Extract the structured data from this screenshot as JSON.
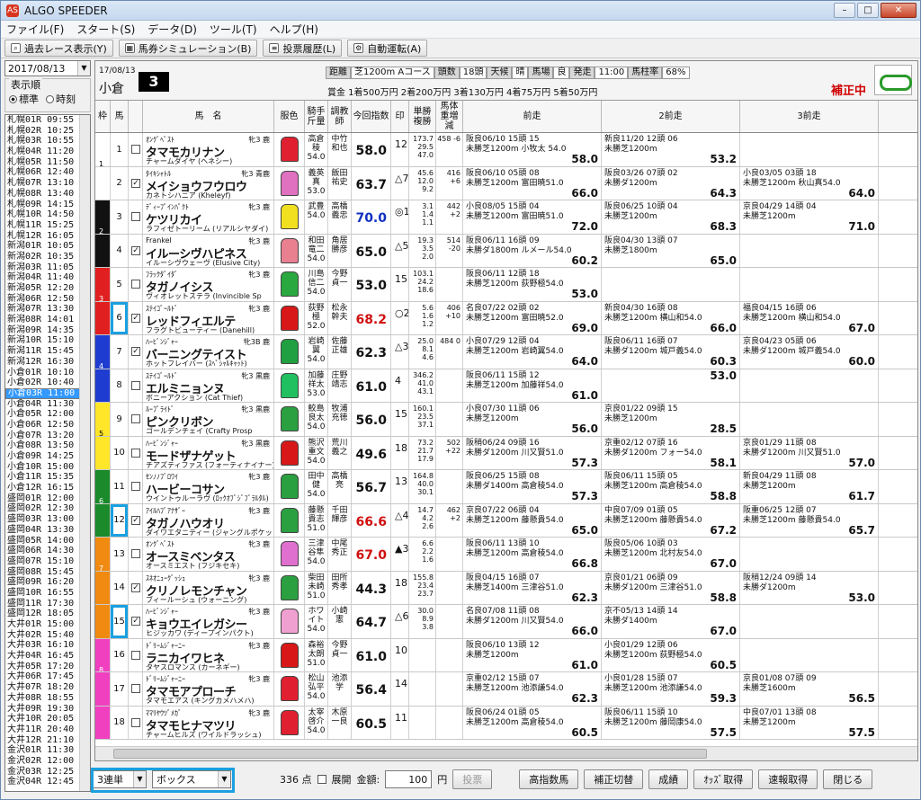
{
  "window": {
    "title": "ALGO SPEEDER"
  },
  "menu": [
    "ファイル(F)",
    "スタート(S)",
    "データ(D)",
    "ツール(T)",
    "ヘルプ(H)"
  ],
  "toolbar": [
    {
      "label": "過去レース表示(Y)",
      "icon": "search-icon"
    },
    {
      "label": "馬券シミュレーション(B)",
      "icon": "grid-icon"
    },
    {
      "label": "投票履歴(L)",
      "icon": "list-icon"
    },
    {
      "label": "自動運転(A)",
      "icon": "gear-icon"
    }
  ],
  "left": {
    "date": "2017/08/13",
    "order_label": "表示順",
    "opt1": "標準",
    "opt2": "時刻",
    "races": [
      "札幌01R 09:55",
      "札幌02R 10:25",
      "札幌03R 10:55",
      "札幌04R 11:20",
      "札幌05R 11:50",
      "札幌06R 12:40",
      "札幌07R 13:10",
      "札幌08R 13:40",
      "札幌09R 14:15",
      "札幌10R 14:50",
      "札幌11R 15:25",
      "札幌12R 16:05",
      "新潟01R 10:05",
      "新潟02R 10:35",
      "新潟03R 11:05",
      "新潟04R 11:40",
      "新潟05R 12:20",
      "新潟06R 12:50",
      "新潟07R 13:30",
      "新潟08R 14:01",
      "新潟09R 14:35",
      "新潟10R 15:10",
      "新潟11R 15:45",
      "新潟12R 16:30",
      "小倉01R 10:10",
      "小倉02R 10:40",
      "小倉03R 11:00",
      "小倉04R 11:30",
      "小倉05R 12:00",
      "小倉06R 12:50",
      "小倉07R 13:20",
      "小倉08R 13:50",
      "小倉09R 14:25",
      "小倉10R 15:00",
      "小倉11R 15:35",
      "小倉12R 16:15",
      "盛岡01R 12:00",
      "盛岡02R 12:30",
      "盛岡03R 13:00",
      "盛岡04R 13:30",
      "盛岡05R 14:00",
      "盛岡06R 14:30",
      "盛岡07R 15:10",
      "盛岡08R 15:45",
      "盛岡09R 16:20",
      "盛岡10R 16:55",
      "盛岡11R 17:30",
      "盛岡12R 18:05",
      "大井01R 15:00",
      "大井02R 15:40",
      "大井03R 16:10",
      "大井04R 16:45",
      "大井05R 17:20",
      "大井06R 17:45",
      "大井07R 18:20",
      "大井08R 18:55",
      "大井09R 19:30",
      "大井10R 20:05",
      "大井11R 20:40",
      "大井12R 21:10",
      "金沢01R 11:30",
      "金沢02R 12:00",
      "金沢03R 12:25",
      "金沢04R 12:45"
    ],
    "selected_index": 26
  },
  "header": {
    "date": "17/08/13",
    "venue": "小倉",
    "race_no": "3",
    "info": [
      [
        "距離",
        true
      ],
      [
        "芝1200m Aコース",
        false
      ],
      [
        "頭数",
        true
      ],
      [
        "18頭",
        false
      ],
      [
        "天候",
        true
      ],
      [
        "晴",
        false
      ],
      [
        "馬場",
        true
      ],
      [
        "良",
        false
      ],
      [
        "発走",
        true
      ],
      [
        "11:00",
        false
      ],
      [
        "馬柱率",
        true
      ],
      [
        "68%",
        false
      ]
    ],
    "prize": "賞金 1着500万円 2着200万円 3着130万円 4着75万円 5着50万円",
    "status": "補正中"
  },
  "columns": [
    "枠",
    "馬",
    "",
    "馬　名",
    "服色",
    "騎手斤量",
    "調教師",
    "今回指数",
    "印",
    "単勝複勝",
    "馬体重増減",
    "前走",
    "2前走",
    "3前走"
  ],
  "horses": [
    {
      "waku": 1,
      "num": "1",
      "chk": false,
      "sire": "ｵﾝｸﾞﾍﾞｽﾄ",
      "tag": "牝3 鹿",
      "name": "タマモカリナン",
      "dam": "チャームダイヤ (ヘネシー)",
      "silk": "#e02030",
      "jockey": "高倉稜 54.0",
      "trainer": "中竹和也",
      "idx": "58.0",
      "ic": "",
      "mark": "12",
      "odds": "173.7 29.5 47.0",
      "wt": "458 -6",
      "p1": "阪良06/10 15頭 15",
      "p1b": "未勝芝1200m 小牧太 54.0",
      "p1c": "58.0",
      "p2": "新良11/20 12頭 06",
      "p2b": "未勝芝1200m",
      "p2c": "53.2",
      "p3": "",
      "p3b": "",
      "p3c": ""
    },
    {
      "waku": 1,
      "num": "2",
      "chk": true,
      "sire": "ﾀｲｷｼｬﾄﾙ",
      "tag": "牝3 青鹿",
      "name": "メイショウフウロウ",
      "dam": "カネトシハニア (Kheleyf)",
      "silk": "#e070c0",
      "jockey": "義英真 53.0",
      "trainer": "飯田祐史",
      "idx": "63.7",
      "ic": "",
      "mark": "△7",
      "odds": "45.6 12.0 9.2",
      "wt": "416 +6",
      "p1": "阪良06/10 05頭 08",
      "p1b": "未勝芝1200m 富田暁51.0",
      "p1c": "66.0",
      "p2": "阪良03/26 07頭 02",
      "p2b": "未勝ダ1200m",
      "p2c": "64.3",
      "p3": "小良03/05 03頭 18",
      "p3b": "未勝芝1200m 秋山真54.0",
      "p3c": "64.0"
    },
    {
      "waku": 2,
      "num": "3",
      "chk": false,
      "sire": "ﾃﾞｨｰﾌﾟｲﾝﾊﾟｸﾄ",
      "tag": "牝3 鹿",
      "name": "ケツリカイ",
      "dam": "ラフィゼトーリーム (リアルシヤダイ)",
      "silk": "#f0e020",
      "jockey": "武豊 54.0",
      "trainer": "高橋義忠",
      "idx": "70.0",
      "ic": "blue",
      "mark": "◎1",
      "odds": "3.1 1.4 1.1",
      "wt": "442 +2",
      "p1": "小良08/05 15頭 04",
      "p1b": "未勝芝1200m 富田暁51.0",
      "p1c": "72.0",
      "p2": "阪良06/25 10頭 04",
      "p2b": "未勝芝1200m",
      "p2c": "68.3",
      "p3": "京良04/29 14頭 04",
      "p3b": "未勝芝1200m",
      "p3c": "71.0"
    },
    {
      "waku": 2,
      "num": "4",
      "chk": true,
      "sire": "Frankel",
      "tag": "牝3 鹿",
      "name": "イルーシヴハピネス",
      "dam": "イルーシヴウェーヴ (Elusive City)",
      "silk": "#e88090",
      "jockey": "和田竜二 54.0",
      "trainer": "角居勝彦",
      "idx": "65.0",
      "ic": "",
      "mark": "△5",
      "odds": "19.3 3.5 2.0",
      "wt": "514 -20",
      "p1": "阪良06/11 16頭 09",
      "p1b": "未勝ダ1800m ルメール54.0",
      "p1c": "60.2",
      "p2": "阪良04/30 13頭 07",
      "p2b": "未勝芝1800m",
      "p2c": "65.0",
      "p3": "",
      "p3b": "",
      "p3c": ""
    },
    {
      "waku": 3,
      "num": "5",
      "chk": false,
      "sire": "ﾌﾗｯｸﾀﾞｲﾀﾞ",
      "tag": "牝3 鹿",
      "name": "タガノイシス",
      "dam": "ヴィオレットステラ (Invincible Sp",
      "silk": "#2aa840",
      "jockey": "川島信二 54.0",
      "trainer": "今野貞一",
      "idx": "53.0",
      "ic": "",
      "mark": "15",
      "odds": "103.1 24.2 18.6",
      "wt": "",
      "p1": "阪良06/11 12頭 18",
      "p1b": "未勝芝1200m 荻野極54.0",
      "p1c": "53.0",
      "p2": "",
      "p2b": "",
      "p2c": "",
      "p3": "",
      "p3b": "",
      "p3c": ""
    },
    {
      "waku": 3,
      "num": "6",
      "chk": true,
      "hl": true,
      "sire": "ｽﾃｲｺﾞｰﾙﾄﾞ",
      "tag": "牝3 鹿",
      "name": "レッドフィエルテ",
      "dam": "フラグトビューティー (Danehill)",
      "silk": "#d81818",
      "jockey": "荻野極 52.0",
      "trainer": "松永幹夫",
      "idx": "68.2",
      "ic": "red",
      "mark": "○2",
      "odds": "5.6 1.6 1.2",
      "wt": "406 +10",
      "p1": "名良07/22 02頭 02",
      "p1b": "未勝芝1200m 富田暁52.0",
      "p1c": "69.0",
      "p2": "新良04/30 16頭 08",
      "p2b": "未勝芝1200m 横山和54.0",
      "p2c": "66.0",
      "p3": "福良04/15 16頭 06",
      "p3b": "未勝芝1200m 横山和54.0",
      "p3c": "67.0"
    },
    {
      "waku": 4,
      "num": "7",
      "chk": true,
      "sire": "ﾊｰﾋﾞﾝｼﾞｬｰ",
      "tag": "牝3B 鹿",
      "name": "バーニングテイスト",
      "dam": "ホットフレイバー (ｽﾍﾟｼｬﾙｷｬｯﾄ)",
      "silk": "#20a040",
      "jockey": "岩崎翼 54.0",
      "trainer": "佐藤正雄",
      "idx": "62.3",
      "ic": "",
      "mark": "△3",
      "odds": "25.0 8.1 4.6",
      "wt": "484 0",
      "p1": "小良07/29 12頭 04",
      "p1b": "未勝芝1200m 岩崎翼54.0",
      "p1c": "64.0",
      "p2": "阪良06/11 16頭 07",
      "p2b": "未勝ダ1200m 城戸義54.0",
      "p2c": "60.3",
      "p3": "京良04/23 05頭 06",
      "p3b": "未勝ダ1200m 城戸義54.0",
      "p3c": "60.0"
    },
    {
      "waku": 4,
      "num": "8",
      "chk": false,
      "sire": "ｽﾃｲｺﾞｰﾙﾄﾞ",
      "tag": "牝3 黒鹿",
      "name": "エルミニョンヌ",
      "dam": "ボニーアクション (Cat Thief)",
      "silk": "#20c060",
      "jockey": "加藤祥太 53.0",
      "trainer": "庄野靖志",
      "idx": "61.0",
      "ic": "",
      "mark": "4",
      "odds": "346.2 41.0 43.1",
      "wt": "",
      "p1": "阪良06/11 15頭 12",
      "p1b": "未勝芝1200m 加藤祥54.0",
      "p1c": "61.0",
      "p2": "",
      "p2b": "",
      "p2c": "53.0",
      "p3": "",
      "p3b": "",
      "p3c": ""
    },
    {
      "waku": 5,
      "num": "9",
      "chk": false,
      "sire": "ﾙｰﾌﾟﾗｲﾄﾞ",
      "tag": "牝3 黒鹿",
      "name": "ピンクリボン",
      "dam": "ゴールデンチェイ (Crafty Prosp",
      "silk": "#2aa040",
      "jockey": "鮫島良太 54.0",
      "trainer": "牧浦充徳",
      "idx": "56.0",
      "ic": "",
      "mark": "15",
      "odds": "160.1 23.5 37.1",
      "wt": "",
      "p1": "小良07/30 11頭 06",
      "p1b": "未勝芝1200m",
      "p1c": "56.0",
      "p2": "京良01/22 09頭 15",
      "p2b": "未勝芝1200m",
      "p2c": "28.5",
      "p3": "",
      "p3b": "",
      "p3c": ""
    },
    {
      "waku": 5,
      "num": "10",
      "chk": false,
      "sire": "ﾊｰﾋﾞﾝｼﾞｬｰ",
      "tag": "牝3 黒鹿",
      "name": "モードザナゲット",
      "dam": "チアズティファス (フォーティナイナー)",
      "silk": "#d81818",
      "jockey": "熊沢重文 54.0",
      "trainer": "荒川義之",
      "idx": "49.6",
      "ic": "",
      "mark": "18",
      "odds": "73.2 21.7 17.9",
      "wt": "502 +22",
      "p1": "阪稍06/24 09頭 16",
      "p1b": "未勝ダ1200m 川又賢51.0",
      "p1c": "57.3",
      "p2": "京重02/12 07頭 16",
      "p2b": "未勝ダ1200m フォー54.0",
      "p2c": "58.1",
      "p3": "京良01/29 11頭 08",
      "p3b": "未勝ダ1200m 川又賢51.0",
      "p3c": "57.0"
    },
    {
      "waku": 6,
      "num": "11",
      "chk": false,
      "sire": "ｾﾝﾉﾉﾌﾞﾛﾜｲ",
      "tag": "牝3 鹿",
      "name": "ハービーコサン",
      "dam": "ウイントゥルーラヴ (ﾛｯｸｵﾌﾞｼﾞﾌﾞﾗﾙﾀﾙ)",
      "silk": "#2aa040",
      "jockey": "田中健 54.0",
      "trainer": "高橋亮",
      "idx": "56.7",
      "ic": "",
      "mark": "13",
      "odds": "164.8 40.0 30.1",
      "wt": "",
      "p1": "阪良06/25 15頭 08",
      "p1b": "未勝ダ1400m 高倉稜54.0",
      "p1c": "57.3",
      "p2": "阪良06/11 15頭 05",
      "p2b": "未勝芝1200m 高倉稜54.0",
      "p2c": "58.8",
      "p3": "新良04/29 11頭 08",
      "p3b": "未勝芝1200m",
      "p3c": "61.7"
    },
    {
      "waku": 6,
      "num": "12",
      "chk": true,
      "hl": true,
      "sire": "ｱｲﾙﾊﾌﾞｱﾅｻﾞｰ",
      "tag": "牝3 鹿",
      "name": "タガノハウオリ",
      "dam": "ダイワエタニティー (ジャングルポケット)",
      "silk": "#2aa040",
      "jockey": "藤懸貴志 51.0",
      "trainer": "千田輝彦",
      "idx": "66.6",
      "ic": "red",
      "mark": "△4",
      "odds": "14.7 4.2 2.6",
      "wt": "462 +2",
      "p1": "京良07/22 06頭 04",
      "p1b": "未勝芝1200m 藤懸貴54.0",
      "p1c": "65.0",
      "p2": "中良07/09 01頭 05",
      "p2b": "未勝芝1200m 藤懸貴54.0",
      "p2c": "67.2",
      "p3": "阪重06/25 12頭 07",
      "p3b": "未勝芝1200m 藤懸貴54.0",
      "p3c": "65.7"
    },
    {
      "waku": 7,
      "num": "13",
      "chk": false,
      "sire": "ｵﾝｸﾞﾍﾞｽﾄ",
      "tag": "牝3 鹿",
      "name": "オースミベンタス",
      "dam": "オースミエスト (フジキセキ)",
      "silk": "#e070d0",
      "jockey": "三津谷隼 54.0",
      "trainer": "中尾秀正",
      "idx": "67.0",
      "ic": "red",
      "mark": "▲3",
      "odds": "6.6 2.2 1.6",
      "wt": "",
      "p1": "阪良06/11 13頭 10",
      "p1b": "未勝芝1200m 高倉稜54.0",
      "p1c": "66.8",
      "p2": "阪良05/06 10頭 03",
      "p2b": "未勝芝1200m 北村友54.0",
      "p2c": "67.0",
      "p3": "",
      "p3b": "",
      "p3c": ""
    },
    {
      "waku": 7,
      "num": "14",
      "chk": true,
      "sire": "ｽﾈｵﾆｭｰｸﾞｯｼｭ",
      "tag": "牝3 鹿",
      "name": "クリノレモンチャン",
      "dam": "ブィールーシュ (ウォーニング)",
      "silk": "#2aa040",
      "jockey": "柴田未崎 51.0",
      "trainer": "田所秀孝",
      "idx": "44.3",
      "ic": "",
      "mark": "18",
      "odds": "155.8 23.4 23.7",
      "wt": "",
      "p1": "阪良04/15 16頭 07",
      "p1b": "未勝芝1400m 三津谷51.0",
      "p1c": "62.3",
      "p2": "京良01/21 06頭 09",
      "p2b": "未勝ダ1200m 三津谷51.0",
      "p2c": "58.8",
      "p3": "阪稍12/24 09頭 14",
      "p3b": "未勝ダ1200m",
      "p3c": "53.0"
    },
    {
      "waku": 7,
      "num": "15",
      "chk": true,
      "hl": true,
      "sire": "ﾊｰﾋﾞﾝｼﾞｬｰ",
      "tag": "牝3 鹿",
      "name": "キョウエイレガシー",
      "dam": "ヒジッカワ (ディープインパクト)",
      "silk": "#f0a0d0",
      "jockey": "ホワイト 54.0",
      "trainer": "小崎憲",
      "idx": "64.7",
      "ic": "",
      "mark": "△6",
      "odds": "30.0 8.9 3.8",
      "wt": "",
      "p1": "名良07/08 11頭 08",
      "p1b": "未勝ダ1200m 川又賢54.0",
      "p1c": "66.0",
      "p2": "京不05/13 14頭 14",
      "p2b": "未勝ダ1400m",
      "p2c": "67.0",
      "p3": "",
      "p3b": "",
      "p3c": ""
    },
    {
      "waku": 8,
      "num": "16",
      "chk": false,
      "sire": "ﾄﾞﾘｰﾑｼﾞｬｰﾆｰ",
      "tag": "牝3 鹿",
      "name": "ラニカイワヒネ",
      "dam": "タヤスロマンス (カーネギー)",
      "silk": "#d81818",
      "jockey": "森裕太朗 51.0",
      "trainer": "今野貞一",
      "idx": "61.0",
      "ic": "",
      "mark": "10",
      "odds": "",
      "wt": "",
      "p1": "阪良06/10 13頭 12",
      "p1b": "未勝芝1200m",
      "p1c": "61.0",
      "p2": "小良01/29 12頭 06",
      "p2b": "未勝芝1200m 荻野極54.0",
      "p2c": "60.5",
      "p3": "",
      "p3b": "",
      "p3c": ""
    },
    {
      "waku": 8,
      "num": "17",
      "chk": false,
      "sire": "ﾄﾞﾘｰﾑｼﾞｬｰﾆｰ",
      "tag": "牝3 鹿",
      "name": "タマモアプローチ",
      "dam": "タマモエアス (キングカメハメハ)",
      "silk": "#e02030",
      "jockey": "松山弘平 54.0",
      "trainer": "池添学",
      "idx": "56.4",
      "ic": "",
      "mark": "14",
      "odds": "",
      "wt": "",
      "p1": "京重02/12 15頭 07",
      "p1b": "未勝芝1200m 池添謙54.0",
      "p1c": "62.3",
      "p2": "小良01/28 15頭 07",
      "p2b": "未勝芝1200m 池添謙54.0",
      "p2c": "59.3",
      "p3": "京良01/08 07頭 09",
      "p3b": "未勝芝1600m",
      "p3c": "56.5"
    },
    {
      "waku": 8,
      "num": "18",
      "chk": false,
      "sire": "ﾏﾏﾘﾔｳﾂﾞﾒｶﾞ",
      "tag": "牝3 鹿",
      "name": "タマモヒナマツリ",
      "dam": "チャームヒルズ (ワイルドラッシュ)",
      "silk": "#e02030",
      "jockey": "太宰啓介 54.0",
      "trainer": "木原一良",
      "idx": "60.5",
      "ic": "",
      "mark": "11",
      "odds": "",
      "wt": "",
      "p1": "阪良06/24 01頭 05",
      "p1b": "未勝芝1200m 高倉稜54.0",
      "p1c": "60.5",
      "p2": "阪良06/11 15頭 10",
      "p2b": "未勝芝1200m 藤岡康54.0",
      "p2c": "57.5",
      "p3": "中良07/01 13頭 08",
      "p3b": "未勝芝1200m",
      "p3c": "57.5"
    }
  ],
  "bottom": {
    "bettype": "3連単",
    "mode": "ボックス",
    "points_label": "336 点",
    "expand": "展開",
    "amount_label": "金額:",
    "amount": "100",
    "yen": "円",
    "buttons": [
      "投票",
      "高指数馬",
      "補正切替",
      "成績",
      "ｵｯｽﾞ取得",
      "速報取得",
      "閉じる"
    ]
  }
}
